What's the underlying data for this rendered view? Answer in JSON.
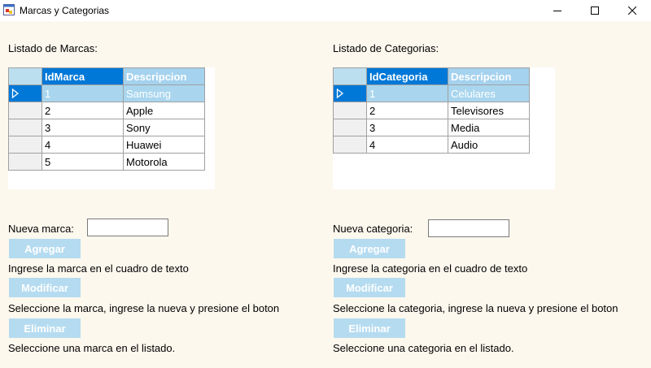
{
  "window": {
    "title": "Marcas y Categorias",
    "icon": "app-window-icon",
    "controls": [
      "minimize-icon",
      "maximize-icon",
      "close-icon"
    ]
  },
  "marcas": {
    "section_label": "Listado de Marcas:",
    "columns": [
      "IdMarca",
      "Descripcion"
    ],
    "rows": [
      {
        "id": "1",
        "desc": "Samsung"
      },
      {
        "id": "2",
        "desc": "Apple"
      },
      {
        "id": "3",
        "desc": "Sony"
      },
      {
        "id": "4",
        "desc": "Huawei"
      },
      {
        "id": "5",
        "desc": "Motorola"
      }
    ],
    "selected_row": 0,
    "input_label": "Nueva marca:",
    "input_value": "",
    "add_button": "Agregar",
    "add_help": "Ingrese la marca en el cuadro de texto",
    "edit_button": "Modificar",
    "edit_help": "Seleccione la marca, ingrese la nueva y presione el boton",
    "delete_button": "Eliminar",
    "delete_help": "Seleccione una marca en el listado."
  },
  "categorias": {
    "section_label": "Listado de Categorias:",
    "columns": [
      "IdCategoria",
      "Descripcion"
    ],
    "rows": [
      {
        "id": "1",
        "desc": "Celulares"
      },
      {
        "id": "2",
        "desc": "Televisores"
      },
      {
        "id": "3",
        "desc": "Media"
      },
      {
        "id": "4",
        "desc": "Audio"
      }
    ],
    "selected_row": 0,
    "input_label": "Nueva categoria:",
    "input_value": "",
    "add_button": "Agregar",
    "add_help": "Ingrese la categoria en el cuadro de texto",
    "edit_button": "Modificar",
    "edit_help": "Seleccione la categoria, ingrese la nueva y presione el boton",
    "delete_button": "Eliminar",
    "delete_help": "Seleccione una categoria en el listado."
  },
  "colors": {
    "form_background": "#fdf8ee",
    "header_selected": "#0078d7",
    "row_selected": "#a9d6ee",
    "button_disabled": "#b5dbf0"
  }
}
